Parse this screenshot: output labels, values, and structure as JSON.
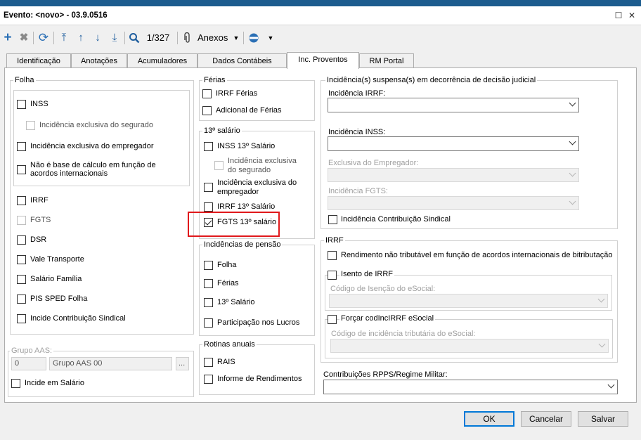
{
  "window": {
    "title": "Evento: <novo> - 03.9.0516"
  },
  "toolbar": {
    "record_counter": "1/327",
    "attachments_label": "Anexos",
    "icons": [
      "add-icon",
      "delete-icon",
      "refresh-icon",
      "first-record-icon",
      "previous-record-icon",
      "next-record-icon",
      "last-record-icon",
      "search-icon",
      "attachment-icon",
      "globe-icon"
    ]
  },
  "tabs": [
    "Identificação",
    "Anotações",
    "Acumuladores",
    "Dados Contábeis",
    "Inc. Proventos",
    "RM Portal"
  ],
  "active_tab": "Inc. Proventos",
  "folha": {
    "title": "Folha",
    "inss": "INSS",
    "exclusiva_segurado": "Incidência exclusiva do segurado",
    "exclusiva_empregador": "Incidência exclusiva do empregador",
    "nao_base_line1": "Não é base de cálculo em função de",
    "nao_base_line2": "acordos internacionais",
    "irrf": "IRRF",
    "fgts": "FGTS",
    "dsr": "DSR",
    "vale_transporte": "Vale Transporte",
    "salario_familia": "Salário Família",
    "pis_sped": "PIS SPED Folha",
    "contrib_sindical": "Incide Contribuição Sindical"
  },
  "grupo_aas": {
    "title": "Grupo AAS:",
    "code": "0",
    "name": "Grupo AAS 00",
    "browse_label": "...",
    "incide_salario": "Incide em Salário"
  },
  "ferias": {
    "title": "Férias",
    "irrf_ferias": "IRRF Férias",
    "adicional": "Adicional de Férias"
  },
  "decimo_terceiro": {
    "title": "13º salário",
    "inss": "INSS 13º Salário",
    "excl_segurado_line1": "Incidência exclusiva",
    "excl_segurado_line2": "do segurado",
    "excl_empregador_line1": "Incidência exclusiva do",
    "excl_empregador_line2": "empregador",
    "irrf": "IRRF 13º Salário",
    "fgts": "FGTS 13º salário",
    "fgts_checked": true
  },
  "pensao": {
    "title": "Incidências de pensão",
    "folha": "Folha",
    "ferias": "Férias",
    "decimo": "13º Salário",
    "lucros": "Participação nos Lucros"
  },
  "rotinas": {
    "title": "Rotinas anuais",
    "rais": "RAIS",
    "informe": "Informe de Rendimentos"
  },
  "suspensa": {
    "title": "Incidência(s) suspensa(s) em decorrência de decisão judicial",
    "irrf": "Incidência IRRF:",
    "inss": "Incidência INSS:",
    "exclusiva_empregador": "Exclusiva do Empregador:",
    "fgts": "Incidência FGTS:",
    "contrib_sindical": "Incidência Contribuição Sindical"
  },
  "irrf_group": {
    "title": "IRRF",
    "rendimento": "Rendimento não tributável em função de acordos internacionais de bitributação",
    "isento": "Isento de IRRF",
    "codigo_isencao": "Código de Isenção do eSocial:",
    "forcar": "Forçar codIncIRRF eSocial",
    "codigo_incidencia": "Código de incidência tributária do eSocial:"
  },
  "rpps": {
    "label": "Contribuições RPPS/Regime Militar:"
  },
  "buttons": {
    "ok": "OK",
    "cancel": "Cancelar",
    "save": "Salvar"
  }
}
